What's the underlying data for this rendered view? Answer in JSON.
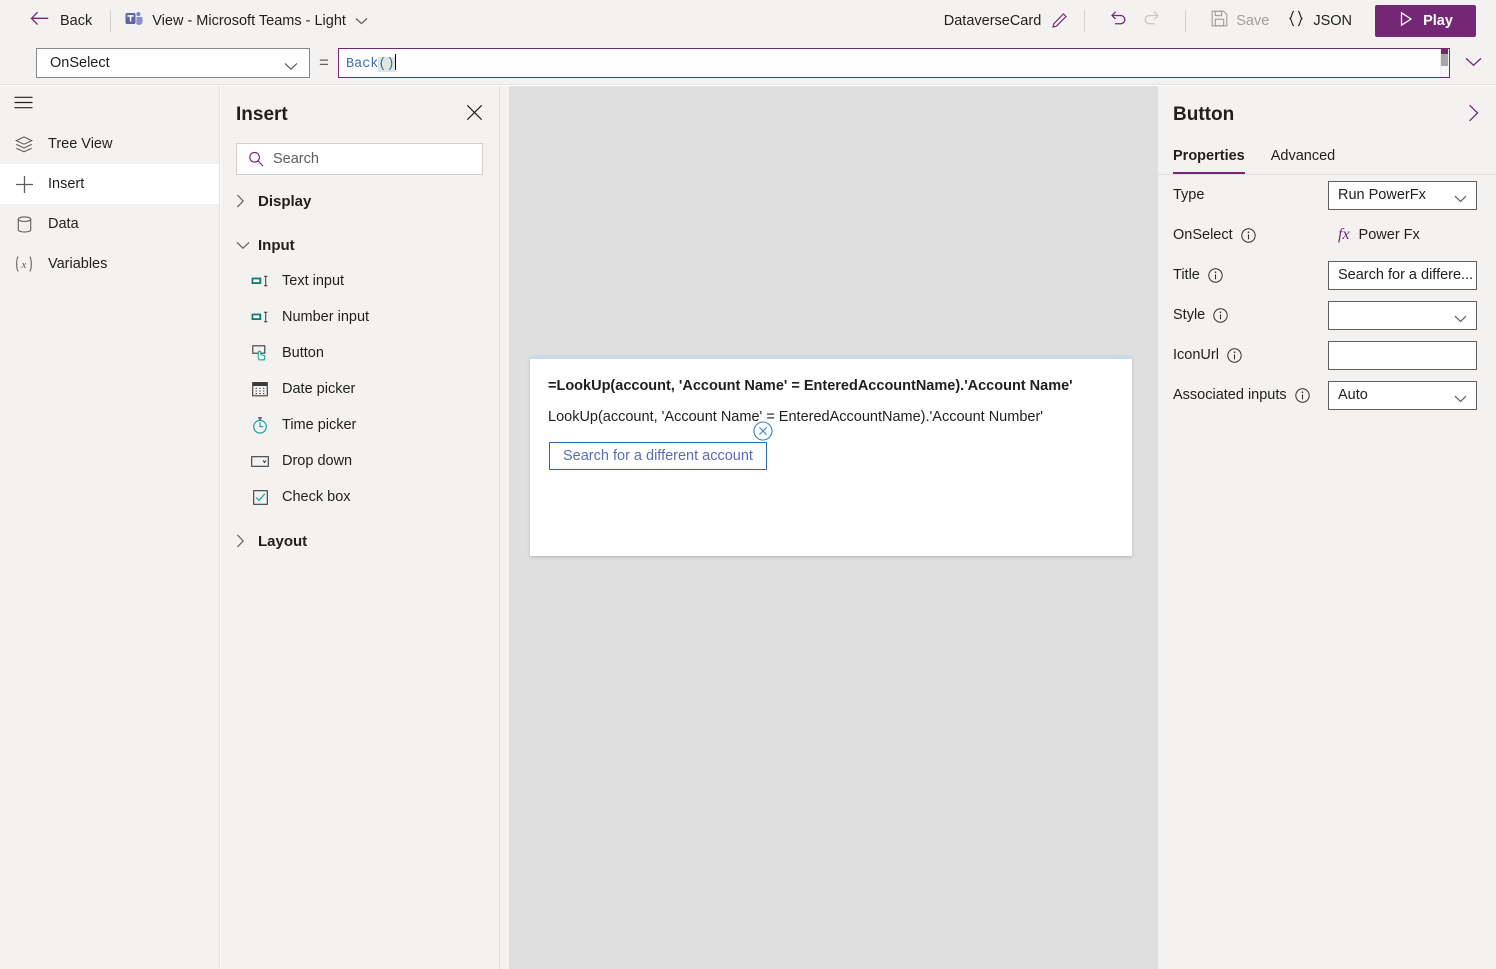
{
  "topbar": {
    "back_label": "Back",
    "back_icon": "arrow-left-icon",
    "doc_title": "View - Microsoft Teams - Light",
    "doc_icon": "microsoft-teams-icon",
    "doc_chevron_icon": "chevron-down-icon",
    "app_name": "DataverseCard",
    "rename_icon": "pencil-icon",
    "undo_icon": "undo-icon",
    "redo_icon": "redo-icon",
    "save_label": "Save",
    "save_icon": "save-disk-icon",
    "json_label": "JSON",
    "json_icon": "curly-braces-icon",
    "play_label": "Play",
    "play_icon": "play-triangle-icon",
    "accent_color": "#742774"
  },
  "formula_bar": {
    "property_selected": "OnSelect",
    "property_chevron_icon": "chevron-down-icon",
    "equals_sign": "=",
    "formula_function": "Back",
    "formula_parens": "()",
    "expand_icon": "chevron-down-icon"
  },
  "rail": {
    "menu_icon": "hamburger-icon",
    "items": [
      {
        "label": "Tree View",
        "icon": "layers-icon",
        "active": false
      },
      {
        "label": "Insert",
        "icon": "plus-icon",
        "active": true
      },
      {
        "label": "Data",
        "icon": "database-icon",
        "active": false
      },
      {
        "label": "Variables",
        "icon": "variable-x-icon",
        "active": false
      }
    ]
  },
  "insert_panel": {
    "title": "Insert",
    "close_icon": "close-x-icon",
    "search": {
      "placeholder": "Search",
      "value": "",
      "icon": "search-icon"
    },
    "groups": [
      {
        "label": "Display",
        "expanded": false,
        "chevron_icon": "chevron-right-icon",
        "items": []
      },
      {
        "label": "Input",
        "expanded": true,
        "chevron_icon": "chevron-down-icon",
        "items": [
          {
            "label": "Text input",
            "icon": "text-input-icon"
          },
          {
            "label": "Number input",
            "icon": "number-input-icon"
          },
          {
            "label": "Button",
            "icon": "button-icon"
          },
          {
            "label": "Date picker",
            "icon": "calendar-icon"
          },
          {
            "label": "Time picker",
            "icon": "clock-icon"
          },
          {
            "label": "Drop down",
            "icon": "dropdown-icon"
          },
          {
            "label": "Check box",
            "icon": "checkbox-icon"
          }
        ]
      },
      {
        "label": "Layout",
        "expanded": false,
        "chevron_icon": "chevron-right-icon",
        "items": []
      }
    ]
  },
  "canvas": {
    "card": {
      "line1": "=LookUp(account, 'Account Name' = EnteredAccountName).'Account Name'",
      "line2": "LookUp(account, 'Account Name' = EnteredAccountName).'Account Number'",
      "button_label": "Search for a different account",
      "remove_icon": "remove-circle-x-icon"
    }
  },
  "properties_panel": {
    "title": "Button",
    "collapse_icon": "chevron-right-icon",
    "tabs": [
      {
        "label": "Properties",
        "active": true
      },
      {
        "label": "Advanced",
        "active": false
      }
    ],
    "rows": [
      {
        "label": "Type",
        "info": false,
        "control": "select",
        "value": "Run PowerFx",
        "chevron_icon": "chevron-down-icon"
      },
      {
        "label": "OnSelect",
        "info": true,
        "control": "fx",
        "value": "Power Fx",
        "fx_icon": "fx-icon"
      },
      {
        "label": "Title",
        "info": true,
        "control": "text",
        "value": "Search for a differe..."
      },
      {
        "label": "Style",
        "info": true,
        "control": "select",
        "value": "",
        "chevron_icon": "chevron-down-icon"
      },
      {
        "label": "IconUrl",
        "info": true,
        "control": "text",
        "value": ""
      },
      {
        "label": "Associated inputs",
        "info": true,
        "control": "select",
        "value": "Auto",
        "chevron_icon": "chevron-down-icon"
      }
    ]
  }
}
